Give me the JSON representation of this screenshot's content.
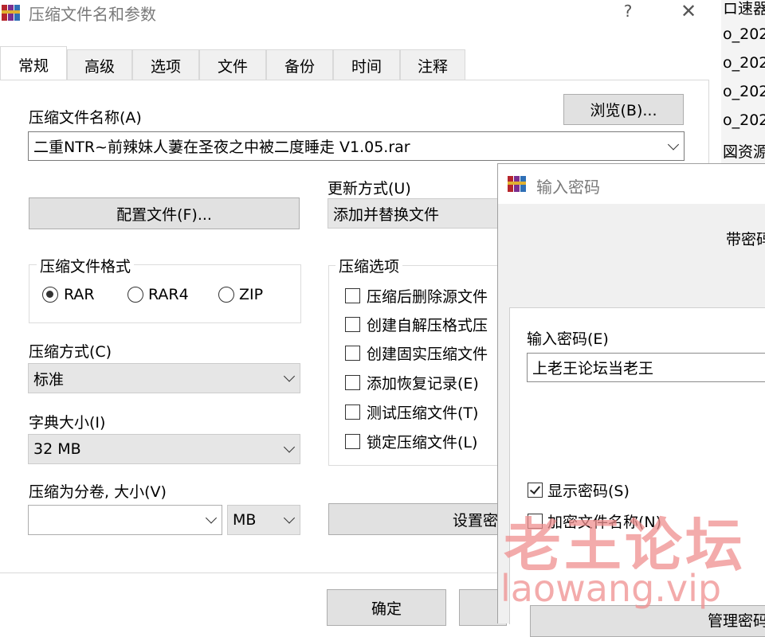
{
  "main_window": {
    "title": "压缩文件名和参数",
    "help_glyph": "?",
    "close_glyph": "✕",
    "tabs": [
      "常规",
      "高级",
      "选项",
      "文件",
      "备份",
      "时间",
      "注释"
    ],
    "archive_name_label": "压缩文件名称(A)",
    "browse_button": "浏览(B)...",
    "archive_name_value": "二重NTR~前辣妹人萋在圣夜之中被二度睡走 V1.05.rar",
    "profile_button": "配置文件(F)...",
    "update_mode_label": "更新方式(U)",
    "update_mode_value": "添加并替换文件",
    "format_group_label": "压缩文件格式",
    "formats": [
      "RAR",
      "RAR4",
      "ZIP"
    ],
    "selected_format": "RAR",
    "method_label": "压缩方式(C)",
    "method_value": "标准",
    "dict_label": "字典大小(I)",
    "dict_value": "32 MB",
    "split_label": "压缩为分卷, 大小(V)",
    "split_value": "",
    "split_unit": "MB",
    "options_group_label": "压缩选项",
    "options": [
      "压缩后删除源文件",
      "创建自解压格式压",
      "创建固实压缩文件",
      "添加恢复记录(E)",
      "测试压缩文件(T)",
      "锁定压缩文件(L)"
    ],
    "set_password_button": "设置密",
    "ok_button": "确定"
  },
  "background_window": {
    "items": [
      "ロ速器",
      "o_202",
      "o_202",
      "o_202",
      "o_202",
      "図资源"
    ]
  },
  "password_dialog": {
    "title": "输入密码",
    "header_text": "带密码",
    "enter_password_label": "输入密码(E)",
    "password_value": "上老王论坛当老王",
    "show_password_label": "显示密码(S)",
    "show_password_checked": true,
    "encrypt_names_label": "加密文件名称(N)",
    "encrypt_names_checked": false,
    "manage_button": "管理密码"
  },
  "watermark": {
    "line1": "老王论坛",
    "line2": "laowang.vip"
  },
  "colors": {
    "dialog_bg": "#f0f0f0",
    "button_bg": "#e1e1e1",
    "combo_gray_bg": "#e6e6e6",
    "winrar_icon_red": "#b6262d",
    "watermark": "#ef8f8f"
  }
}
